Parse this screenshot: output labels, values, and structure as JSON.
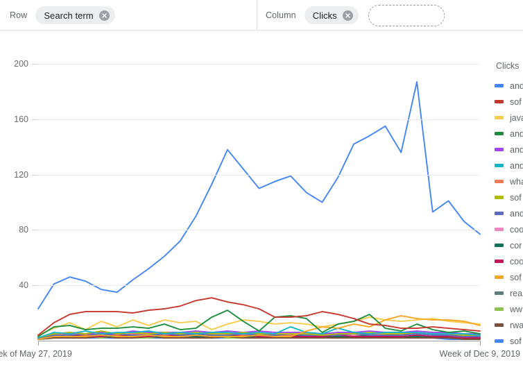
{
  "pivot_bar": {
    "row": {
      "label": "Row",
      "chip": "Search term",
      "remove_icon": "close-icon"
    },
    "column": {
      "label": "Column",
      "chip": "Clicks",
      "remove_icon": "close-icon"
    },
    "dropzone_placeholder": ""
  },
  "legend": {
    "title": "Clicks",
    "items": [
      {
        "label": "and",
        "color": "#4285f4"
      },
      {
        "label": "sof",
        "color": "#c5372c"
      },
      {
        "label": "java",
        "color": "#f7cb4d"
      },
      {
        "label": "and",
        "color": "#1e8e3e"
      },
      {
        "label": "and",
        "color": "#a142f4"
      },
      {
        "label": "and",
        "color": "#12b5cb"
      },
      {
        "label": "wha",
        "color": "#f07b53"
      },
      {
        "label": "sof",
        "color": "#b0bc00"
      },
      {
        "label": "and",
        "color": "#5c6bc0"
      },
      {
        "label": "coo",
        "color": "#ef86bf"
      },
      {
        "label": "cor",
        "color": "#12715a"
      },
      {
        "label": "coo",
        "color": "#c2185b"
      },
      {
        "label": "sof",
        "color": "#f5a623"
      },
      {
        "label": "rea",
        "color": "#5a7d7c"
      },
      {
        "label": "ww",
        "color": "#8bc34a"
      },
      {
        "label": "rwa",
        "color": "#7b4f37"
      },
      {
        "label": "sof",
        "color": "#4285f4"
      }
    ]
  },
  "chart_data": {
    "type": "line",
    "title": "",
    "xlabel": "",
    "ylabel": "Clicks",
    "ylim": [
      0,
      200
    ],
    "yticks": [
      200,
      160,
      120,
      80,
      40
    ],
    "grid": true,
    "legend_position": "right",
    "x_tick_labels": [
      "eek of May 27, 2019",
      "Week of Dec 9, 2019"
    ],
    "x_count": 29,
    "series": [
      {
        "name": "and",
        "color": "#4285f4",
        "values": [
          23,
          41,
          46,
          43,
          37,
          35,
          44,
          52,
          61,
          72,
          90,
          113,
          138,
          124,
          110,
          115,
          119,
          107,
          100,
          118,
          142,
          148,
          155,
          136,
          187,
          93,
          101,
          86,
          77
        ]
      },
      {
        "name": "sof",
        "color": "#c5372c",
        "values": [
          4,
          13,
          19,
          21,
          21,
          21,
          20,
          22,
          23,
          25,
          29,
          31,
          28,
          26,
          23,
          17,
          17,
          18,
          21,
          19,
          16,
          12,
          11,
          9,
          9,
          10,
          9,
          8,
          7
        ]
      },
      {
        "name": "java",
        "color": "#f7cb4d",
        "values": [
          4,
          9,
          13,
          8,
          14,
          10,
          15,
          11,
          15,
          13,
          14,
          8,
          12,
          15,
          14,
          12,
          13,
          12,
          10,
          12,
          14,
          17,
          15,
          14,
          15,
          16,
          14,
          13,
          12
        ]
      },
      {
        "name": "and",
        "color": "#1e8e3e",
        "values": [
          3,
          10,
          11,
          8,
          9,
          9,
          10,
          9,
          12,
          8,
          9,
          17,
          22,
          14,
          7,
          17,
          18,
          16,
          6,
          12,
          14,
          19,
          9,
          7,
          12,
          8,
          6,
          7,
          5
        ]
      },
      {
        "name": "and",
        "color": "#a142f4",
        "values": [
          2,
          5,
          6,
          5,
          6,
          5,
          7,
          6,
          6,
          6,
          7,
          6,
          7,
          6,
          7,
          6,
          6,
          6,
          5,
          6,
          6,
          7,
          6,
          6,
          7,
          6,
          6,
          5,
          5
        ]
      },
      {
        "name": "and",
        "color": "#12b5cb",
        "values": [
          2,
          6,
          5,
          7,
          5,
          6,
          6,
          7,
          5,
          6,
          5,
          6,
          6,
          5,
          6,
          5,
          10,
          6,
          5,
          9,
          6,
          5,
          6,
          6,
          6,
          5,
          5,
          5,
          4
        ]
      },
      {
        "name": "wha",
        "color": "#f07b53",
        "values": [
          2,
          4,
          5,
          4,
          5,
          4,
          5,
          5,
          4,
          5,
          4,
          5,
          5,
          4,
          5,
          4,
          4,
          5,
          4,
          5,
          5,
          5,
          4,
          5,
          5,
          4,
          4,
          4,
          3
        ]
      },
      {
        "name": "sof",
        "color": "#b0bc00",
        "values": [
          2,
          5,
          6,
          5,
          7,
          5,
          6,
          5,
          6,
          5,
          6,
          5,
          5,
          6,
          5,
          5,
          5,
          5,
          4,
          5,
          5,
          6,
          5,
          5,
          6,
          5,
          5,
          4,
          4
        ]
      },
      {
        "name": "and",
        "color": "#5c6bc0",
        "values": [
          2,
          4,
          4,
          5,
          4,
          5,
          4,
          4,
          5,
          4,
          5,
          4,
          4,
          5,
          4,
          4,
          5,
          4,
          4,
          4,
          5,
          4,
          4,
          4,
          5,
          4,
          4,
          3,
          3
        ]
      },
      {
        "name": "coo",
        "color": "#ef86bf",
        "values": [
          1,
          3,
          4,
          3,
          4,
          4,
          3,
          4,
          4,
          3,
          4,
          4,
          3,
          4,
          3,
          4,
          3,
          4,
          3,
          4,
          4,
          3,
          4,
          3,
          4,
          3,
          3,
          3,
          2
        ]
      },
      {
        "name": "cor",
        "color": "#12715a",
        "values": [
          1,
          3,
          3,
          4,
          3,
          3,
          4,
          3,
          3,
          4,
          3,
          3,
          4,
          3,
          3,
          3,
          4,
          3,
          3,
          3,
          3,
          4,
          3,
          3,
          3,
          3,
          3,
          2,
          2
        ]
      },
      {
        "name": "coo",
        "color": "#c2185b",
        "values": [
          1,
          3,
          4,
          3,
          3,
          4,
          3,
          3,
          4,
          3,
          4,
          3,
          3,
          4,
          3,
          3,
          3,
          3,
          3,
          4,
          3,
          3,
          3,
          3,
          4,
          3,
          3,
          2,
          2
        ]
      },
      {
        "name": "sof",
        "color": "#f5a623",
        "values": [
          1,
          3,
          3,
          3,
          4,
          3,
          3,
          4,
          3,
          3,
          4,
          3,
          3,
          3,
          4,
          3,
          3,
          7,
          10,
          9,
          12,
          10,
          15,
          18,
          16,
          15,
          15,
          14,
          11
        ]
      },
      {
        "name": "rea",
        "color": "#5a7d7c",
        "values": [
          1,
          2,
          3,
          2,
          3,
          2,
          3,
          2,
          3,
          2,
          3,
          2,
          3,
          2,
          3,
          2,
          3,
          2,
          2,
          3,
          2,
          3,
          2,
          2,
          3,
          2,
          2,
          2,
          2
        ]
      },
      {
        "name": "ww",
        "color": "#8bc34a",
        "values": [
          1,
          2,
          2,
          3,
          2,
          3,
          2,
          2,
          3,
          2,
          2,
          3,
          2,
          2,
          3,
          2,
          2,
          2,
          2,
          2,
          3,
          2,
          2,
          2,
          2,
          2,
          2,
          2,
          1
        ]
      },
      {
        "name": "rwa",
        "color": "#7b4f37",
        "values": [
          1,
          2,
          2,
          2,
          3,
          2,
          2,
          3,
          2,
          2,
          2,
          2,
          3,
          2,
          2,
          2,
          2,
          2,
          2,
          2,
          2,
          2,
          2,
          2,
          2,
          2,
          2,
          1,
          1
        ]
      },
      {
        "name": "sof",
        "color": "#4285f4",
        "values": [
          1,
          2,
          2,
          2,
          2,
          2,
          2,
          2,
          2,
          2,
          2,
          2,
          2,
          2,
          2,
          2,
          2,
          2,
          2,
          2,
          2,
          2,
          2,
          2,
          2,
          2,
          1,
          1,
          1
        ]
      }
    ]
  }
}
